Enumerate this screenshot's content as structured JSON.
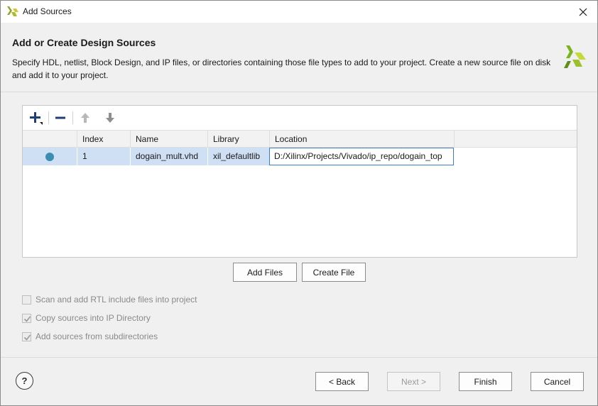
{
  "window": {
    "title": "Add Sources",
    "app_icon": "xilinx-logo-icon",
    "close_icon": "close-icon"
  },
  "header": {
    "heading": "Add or Create Design Sources",
    "description": "Specify HDL, netlist, Block Design, and IP files, or directories containing those file types to add to your project. Create a new source file on disk and add it to your project.",
    "logo": "xilinx-logo-icon"
  },
  "toolbar": {
    "icons": [
      "plus-icon",
      "minus-icon",
      "arrow-up-icon",
      "arrow-down-icon"
    ]
  },
  "table": {
    "columns": [
      "",
      "Index",
      "Name",
      "Library",
      "Location"
    ],
    "rows": [
      {
        "status": "status-dot-icon",
        "index": "1",
        "name": "dogain_mult.vhd",
        "library": "xil_defaultlib",
        "location": "D:/Xilinx/Projects/Vivado/ip_repo/dogain_top"
      }
    ]
  },
  "actions": {
    "add_files": "Add Files",
    "create_file": "Create File"
  },
  "options": [
    {
      "label": "Scan and add RTL include files into project",
      "checked": false,
      "enabled": false
    },
    {
      "label": "Copy sources into IP Directory",
      "checked": true,
      "enabled": false
    },
    {
      "label": "Add sources from subdirectories",
      "checked": true,
      "enabled": false
    }
  ],
  "footer": {
    "help": "?",
    "back": "< Back",
    "next": "Next >",
    "finish": "Finish",
    "cancel": "Cancel"
  },
  "colors": {
    "selection": "#cfe0f5",
    "status_dot": "#3d8db1",
    "logo_green": "#7ab51d",
    "logo_yellow": "#c6d93b"
  }
}
